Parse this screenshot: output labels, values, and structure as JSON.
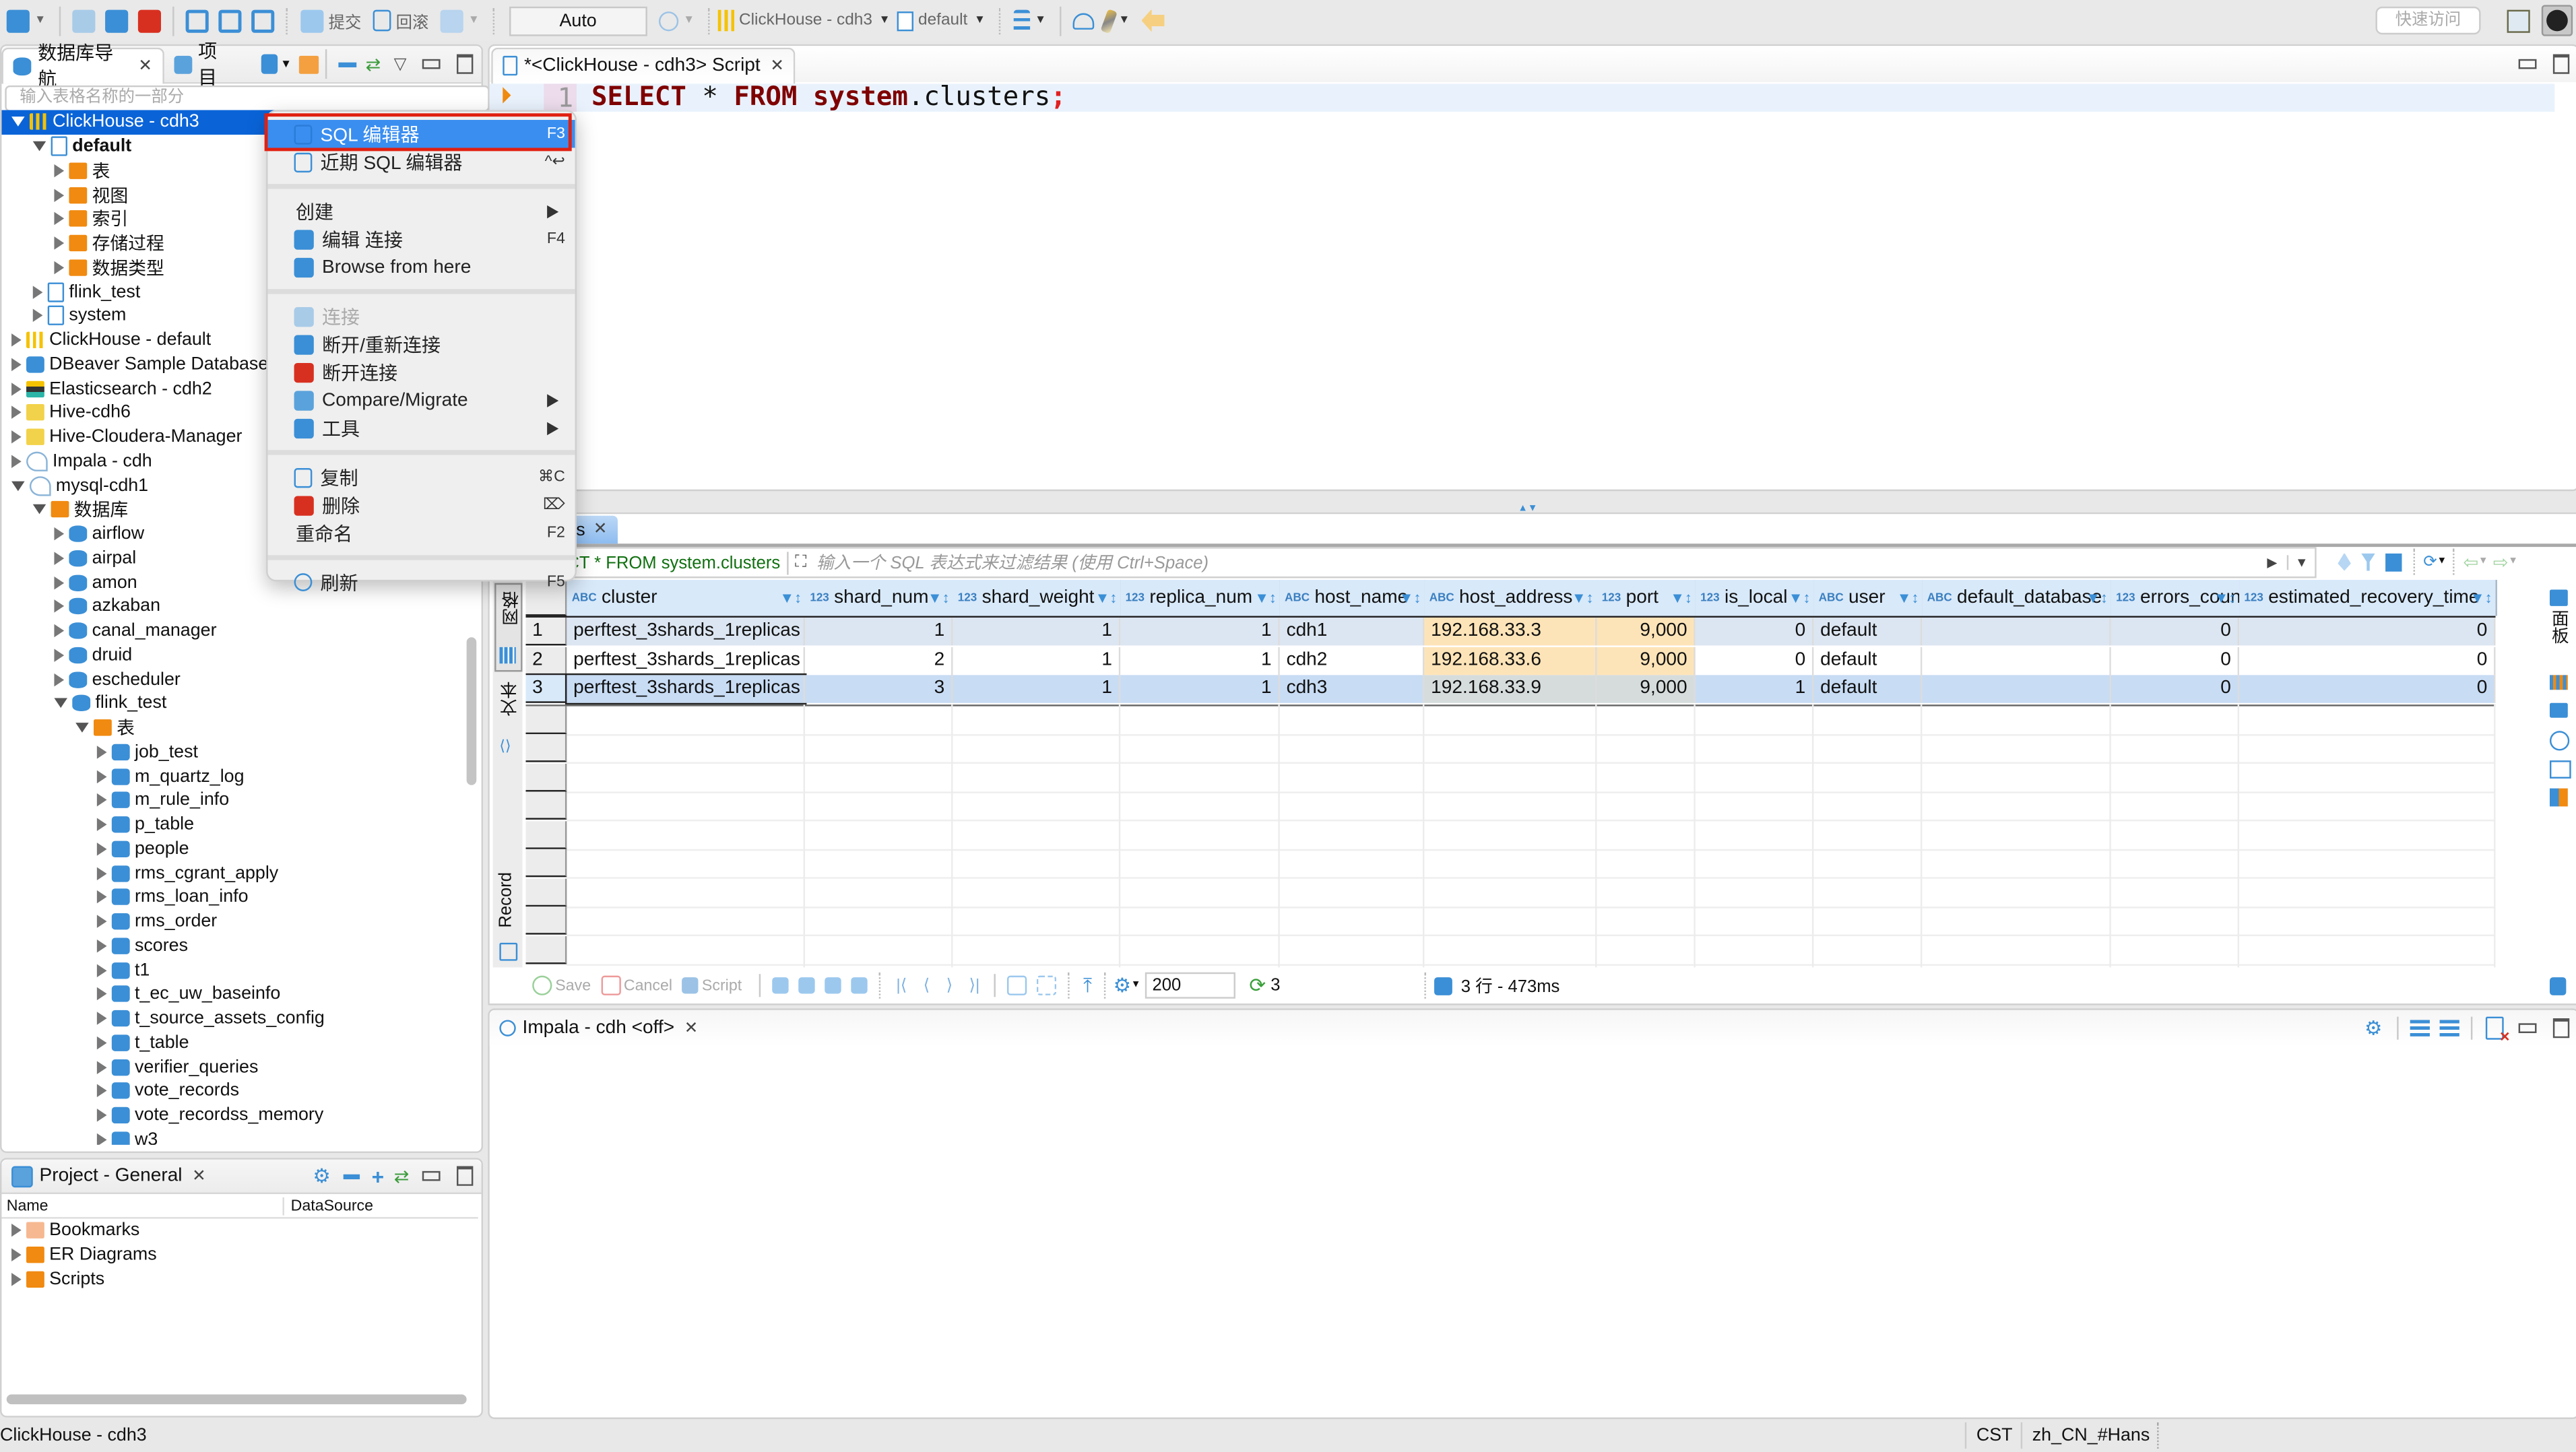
{
  "toolbar": {
    "commit_label": "提交",
    "rollback_label": "回滚",
    "transaction_mode": "Auto",
    "active_datasource": "ClickHouse - cdh3",
    "active_schema": "default",
    "quick_access_placeholder": "快速访问"
  },
  "navigator": {
    "tab_label": "数据库导航",
    "projects_tab_label": "项目",
    "filter_placeholder": "输入表格名称的一部分",
    "tree": [
      {
        "label": "ClickHouse - cdh3",
        "level": 0,
        "expanded": true,
        "icon": "clickhouse-icon",
        "selected": true
      },
      {
        "label": "default",
        "level": 1,
        "expanded": true,
        "icon": "schema-icon",
        "bold": true
      },
      {
        "label": "表",
        "level": 2,
        "expanded": false,
        "icon": "tables-folder-icon"
      },
      {
        "label": "视图",
        "level": 2,
        "expanded": false,
        "icon": "views-folder-icon"
      },
      {
        "label": "索引",
        "level": 2,
        "expanded": false,
        "icon": "folder-icon"
      },
      {
        "label": "存储过程",
        "level": 2,
        "expanded": false,
        "icon": "folder-icon"
      },
      {
        "label": "数据类型",
        "level": 2,
        "expanded": false,
        "icon": "folder-icon"
      },
      {
        "label": "flink_test",
        "level": 1,
        "expanded": false,
        "icon": "schema-icon"
      },
      {
        "label": "system",
        "level": 1,
        "expanded": false,
        "icon": "schema-icon"
      },
      {
        "label": "ClickHouse - default",
        "level": 0,
        "expanded": false,
        "icon": "clickhouse-icon"
      },
      {
        "label": "DBeaver Sample Database",
        "level": 0,
        "expanded": false,
        "icon": "sqlite-icon"
      },
      {
        "label": "Elasticsearch - cdh2",
        "level": 0,
        "expanded": false,
        "icon": "elasticsearch-icon"
      },
      {
        "label": "Hive-cdh6",
        "level": 0,
        "expanded": false,
        "icon": "hive-icon"
      },
      {
        "label": "Hive-Cloudera-Manager",
        "level": 0,
        "expanded": false,
        "icon": "hive-icon"
      },
      {
        "label": "Impala - cdh",
        "level": 0,
        "expanded": false,
        "icon": "impala-icon"
      },
      {
        "label": "mysql-cdh1",
        "level": 0,
        "expanded": true,
        "icon": "mysql-icon"
      },
      {
        "label": "数据库",
        "level": 1,
        "expanded": true,
        "icon": "databases-folder-icon"
      },
      {
        "label": "airflow",
        "level": 2,
        "expanded": false,
        "icon": "database-icon"
      },
      {
        "label": "airpal",
        "level": 2,
        "expanded": false,
        "icon": "database-icon"
      },
      {
        "label": "amon",
        "level": 2,
        "expanded": false,
        "icon": "database-icon"
      },
      {
        "label": "azkaban",
        "level": 2,
        "expanded": false,
        "icon": "database-icon"
      },
      {
        "label": "canal_manager",
        "level": 2,
        "expanded": false,
        "icon": "database-icon"
      },
      {
        "label": "druid",
        "level": 2,
        "expanded": false,
        "icon": "database-icon"
      },
      {
        "label": "escheduler",
        "level": 2,
        "expanded": false,
        "icon": "database-icon"
      },
      {
        "label": "flink_test",
        "level": 2,
        "expanded": true,
        "icon": "database-icon"
      },
      {
        "label": "表",
        "level": 3,
        "expanded": true,
        "icon": "tables-folder-icon"
      },
      {
        "label": "job_test",
        "level": 4,
        "expanded": false,
        "icon": "table-icon"
      },
      {
        "label": "m_quartz_log",
        "level": 4,
        "expanded": false,
        "icon": "table-icon"
      },
      {
        "label": "m_rule_info",
        "level": 4,
        "expanded": false,
        "icon": "table-icon"
      },
      {
        "label": "p_table",
        "level": 4,
        "expanded": false,
        "icon": "table-icon"
      },
      {
        "label": "people",
        "level": 4,
        "expanded": false,
        "icon": "table-icon"
      },
      {
        "label": "rms_cgrant_apply",
        "level": 4,
        "expanded": false,
        "icon": "table-icon"
      },
      {
        "label": "rms_loan_info",
        "level": 4,
        "expanded": false,
        "icon": "table-icon"
      },
      {
        "label": "rms_order",
        "level": 4,
        "expanded": false,
        "icon": "table-icon"
      },
      {
        "label": "scores",
        "level": 4,
        "expanded": false,
        "icon": "table-icon"
      },
      {
        "label": "t1",
        "level": 4,
        "expanded": false,
        "icon": "table-icon"
      },
      {
        "label": "t_ec_uw_baseinfo",
        "level": 4,
        "expanded": false,
        "icon": "table-icon"
      },
      {
        "label": "t_source_assets_config",
        "level": 4,
        "expanded": false,
        "icon": "table-icon"
      },
      {
        "label": "t_table",
        "level": 4,
        "expanded": false,
        "icon": "table-icon"
      },
      {
        "label": "verifier_queries",
        "level": 4,
        "expanded": false,
        "icon": "table-icon"
      },
      {
        "label": "vote_records",
        "level": 4,
        "expanded": false,
        "icon": "table-icon"
      },
      {
        "label": "vote_recordss_memory",
        "level": 4,
        "expanded": false,
        "icon": "table-icon"
      },
      {
        "label": "w3",
        "level": 4,
        "expanded": false,
        "icon": "table-icon"
      }
    ]
  },
  "context_menu": {
    "items": [
      {
        "label": "SQL 编辑器",
        "shortcut": "F3",
        "icon": "sql-editor-icon",
        "selected": true
      },
      {
        "label": "近期 SQL 编辑器",
        "shortcut": "^↩",
        "icon": "recent-sql-editor-icon"
      },
      {
        "separator": true
      },
      {
        "label": "创建",
        "submenu": true
      },
      {
        "label": "编辑 连接",
        "shortcut": "F4",
        "icon": "pencil-icon"
      },
      {
        "label": "Browse from here",
        "icon": "browse-database-icon"
      },
      {
        "separator": true
      },
      {
        "label": "连接",
        "icon": "connect-icon",
        "disabled": true
      },
      {
        "label": "断开/重新连接",
        "icon": "reconnect-icon"
      },
      {
        "label": "断开连接",
        "icon": "disconnect-icon"
      },
      {
        "label": "Compare/Migrate",
        "icon": "compare-icon",
        "submenu": true
      },
      {
        "label": "工具",
        "icon": "tools-icon",
        "submenu": true
      },
      {
        "separator": true
      },
      {
        "label": "复制",
        "shortcut": "⌘C",
        "icon": "copy-icon"
      },
      {
        "label": "删除",
        "shortcut": "⌦",
        "icon": "trash-icon"
      },
      {
        "label": "重命名",
        "shortcut": "F2"
      },
      {
        "separator": true
      },
      {
        "label": "刷新",
        "shortcut": "F5",
        "icon": "refresh-icon"
      }
    ]
  },
  "editor": {
    "tab_label": "*<ClickHouse - cdh3> Script",
    "line_number": "1",
    "sql_tokens": [
      {
        "text": "SELECT",
        "kind": "keyword"
      },
      {
        "text": " * ",
        "kind": "plain"
      },
      {
        "text": "FROM",
        "kind": "keyword"
      },
      {
        "text": " ",
        "kind": "plain"
      },
      {
        "text": "system",
        "kind": "keyword"
      },
      {
        "text": ".clusters",
        "kind": "plain"
      },
      {
        "text": ";",
        "kind": "punct"
      }
    ]
  },
  "results": {
    "tab_label": "rs",
    "query_text": "CT * FROM system.clusters",
    "filter_placeholder": "输入一个 SQL 表达式来过滤结果 (使用 Ctrl+Space)",
    "side_tabs": [
      "网格",
      "文本",
      "Record"
    ],
    "right_panel_label": "面板",
    "columns": [
      {
        "name": "cluster",
        "type": "ABC"
      },
      {
        "name": "shard_num",
        "type": "123"
      },
      {
        "name": "shard_weight",
        "type": "123"
      },
      {
        "name": "replica_num",
        "type": "123"
      },
      {
        "name": "host_name",
        "type": "ABC"
      },
      {
        "name": "host_address",
        "type": "ABC"
      },
      {
        "name": "port",
        "type": "123"
      },
      {
        "name": "is_local",
        "type": "123"
      },
      {
        "name": "user",
        "type": "ABC"
      },
      {
        "name": "default_database",
        "type": "ABC"
      },
      {
        "name": "errors_count",
        "type": "123"
      },
      {
        "name": "estimated_recovery_time",
        "type": "123"
      }
    ],
    "rows": [
      [
        "perftest_3shards_1replicas",
        "1",
        "1",
        "1",
        "cdh1",
        "192.168.33.3",
        "9,000",
        "0",
        "default",
        "",
        "0",
        "0"
      ],
      [
        "perftest_3shards_1replicas",
        "2",
        "1",
        "1",
        "cdh2",
        "192.168.33.6",
        "9,000",
        "0",
        "default",
        "",
        "0",
        "0"
      ],
      [
        "perftest_3shards_1replicas",
        "3",
        "1",
        "1",
        "cdh3",
        "192.168.33.9",
        "9,000",
        "1",
        "default",
        "",
        "0",
        "0"
      ]
    ],
    "row_numbers": [
      "1",
      "2",
      "3"
    ],
    "bottom": {
      "save_label": "Save",
      "cancel_label": "Cancel",
      "script_label": "Script",
      "fetch_size": "200",
      "refresh_count": "3",
      "status": "3 行 - 473ms"
    }
  },
  "bottom_panel": {
    "tab_label": "Impala - cdh <off>"
  },
  "project_panel": {
    "tab_label": "Project - General",
    "col_name": "Name",
    "col_datasource": "DataSource",
    "items": [
      {
        "label": "Bookmarks",
        "icon": "bookmarks-folder-icon"
      },
      {
        "label": "ER Diagrams",
        "icon": "er-diagrams-folder-icon"
      },
      {
        "label": "Scripts",
        "icon": "scripts-folder-icon"
      }
    ]
  },
  "statusbar": {
    "left": "ClickHouse - cdh3",
    "timezone": "CST",
    "locale": "zh_CN_#Hans"
  },
  "colors": {
    "selection": "#0a64d8",
    "menu_highlight": "#3a8ef0",
    "highlight_box": "#e02010",
    "sql_keyword": "#7f0000",
    "changed_cell": "#fde4b8",
    "grid_header": "#d8e9fa"
  }
}
